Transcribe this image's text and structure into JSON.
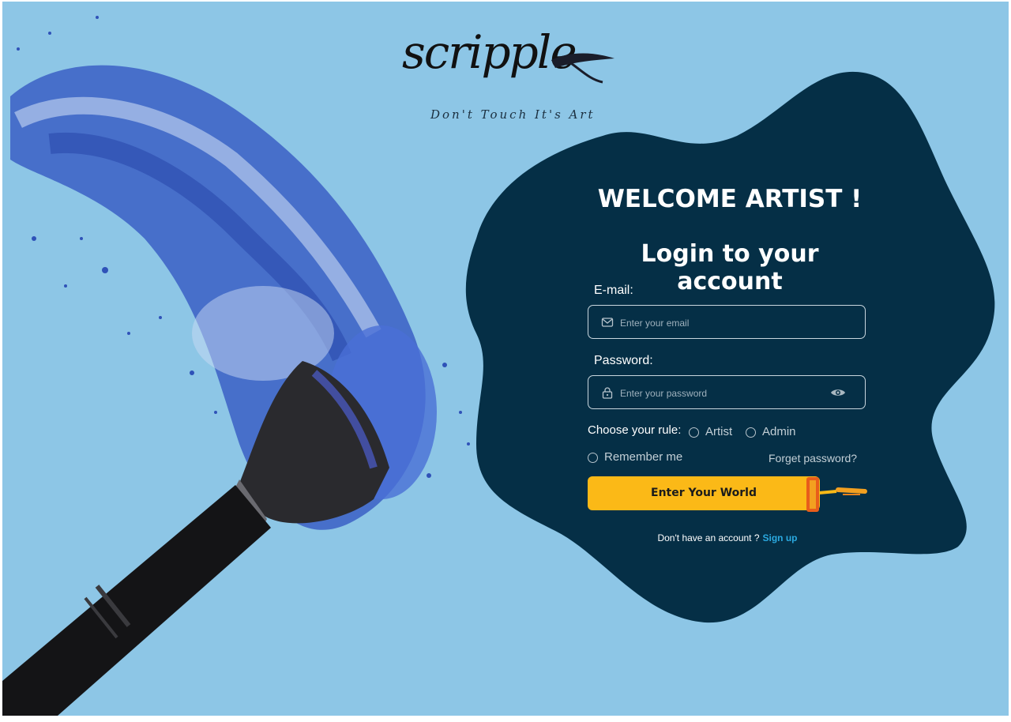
{
  "brand": {
    "name": "scripple",
    "tagline": "Don't Touch It's Art"
  },
  "card": {
    "welcome": "WELCOME ARTIST !",
    "title": "Login to your account",
    "email_label": "E-mail:",
    "email_placeholder": "Enter your email",
    "password_label": "Password:",
    "password_placeholder": "Enter your password",
    "rule_label": "Choose your rule:",
    "rule_options": [
      "Artist",
      "Admin"
    ],
    "remember_label": "Remember me",
    "forgot_label": "Forget password?",
    "submit_label": "Enter Your World",
    "signup_prompt": "Don't have an account ?",
    "signup_link": "Sign up"
  },
  "icons": {
    "email": "mail-icon",
    "password": "lock-icon",
    "toggle": "eye-icon"
  },
  "colors": {
    "background": "#8dc6e6",
    "card": "#052f46",
    "accent": "#fbb917",
    "link": "#2aa9e0"
  }
}
